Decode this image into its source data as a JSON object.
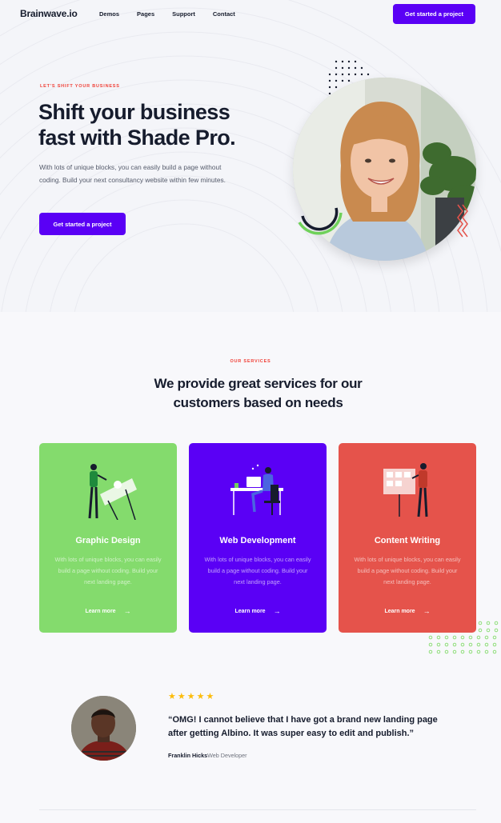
{
  "nav": {
    "logo": "Brainwave.io",
    "links": [
      "Demos",
      "Pages",
      "Support",
      "Contact"
    ],
    "cta": "Get started a project"
  },
  "hero": {
    "eyebrow": "LET'S SHIFT YOUR BUSINESS",
    "title_line1": "Shift your business",
    "title_line2": "fast with Shade Pro.",
    "text": "With lots of unique blocks, you can easily build a page without coding. Build your next consultancy website within few minutes.",
    "cta": "Get started a project"
  },
  "services": {
    "eyebrow": "OUR SERVICES",
    "title_line1": "We provide great services for our",
    "title_line2": "customers based on needs",
    "cards": [
      {
        "title": "Graphic Design",
        "text": "With lots of unique blocks, you can easily build a page without coding. Build your next landing page.",
        "link": "Learn more",
        "color": "#84db6d"
      },
      {
        "title": "Web Development",
        "text": "With lots of unique blocks, you can easily build a page without coding. Build your next landing page.",
        "link": "Learn more",
        "color": "#5a00f5"
      },
      {
        "title": "Content Writing",
        "text": "With lots of unique blocks, you can easily build a page without coding. Build your next landing page.",
        "link": "Learn more",
        "color": "#e5534b"
      }
    ]
  },
  "testimonial": {
    "rating": 5,
    "quote_line1": "“OMG! I cannot believe that I have got a brand new landing page",
    "quote_line2": "after getting Albino. It was super easy to edit and publish.”",
    "author_name": "Franklin Hicks",
    "author_role": "Web Developer"
  },
  "colors": {
    "primary": "#5a00f5",
    "accent_red": "#f04037",
    "star": "#fcbc0b",
    "text_dark": "#161c2d"
  }
}
